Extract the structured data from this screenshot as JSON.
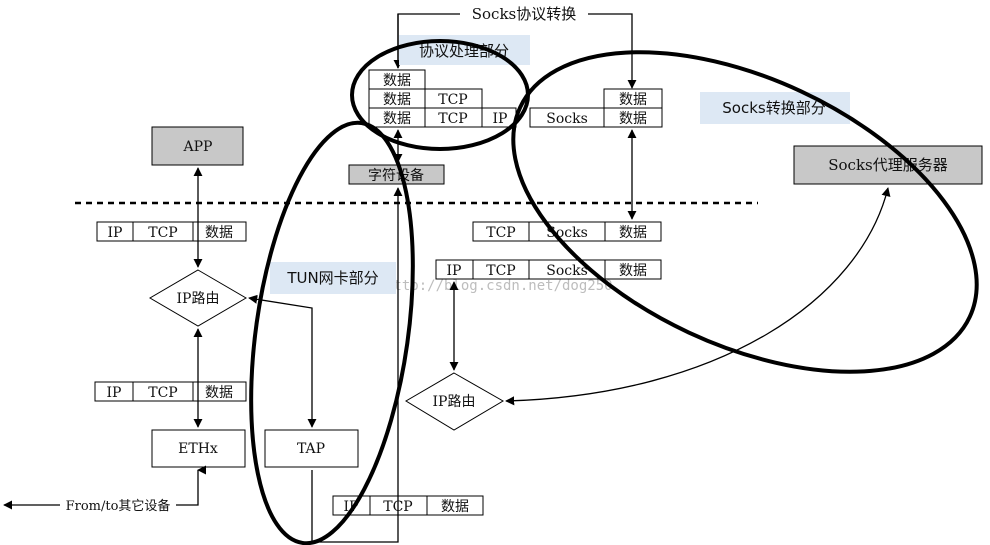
{
  "title_top": "Socks协议转换",
  "regions": {
    "protocol": "协议处理部分",
    "socks": "Socks转换部分",
    "tun": "TUN网卡部分"
  },
  "nodes": {
    "app": "APP",
    "char_device": "字符设备",
    "socks_proxy": "Socks代理服务器",
    "ip_route_left": "IP路由",
    "ip_route_right": "IP路由",
    "ethx": "ETHx",
    "tap": "TAP",
    "from_to": "From/to其它设备"
  },
  "packets": {
    "p1": [
      "数据"
    ],
    "p2": [
      "数据",
      "TCP"
    ],
    "p3": [
      "数据",
      "TCP",
      "IP"
    ],
    "p4": [
      "数据"
    ],
    "p5": [
      "Socks",
      "数据"
    ],
    "app_pkt": [
      "IP",
      "TCP",
      "数据"
    ],
    "eth_pkt": [
      "IP",
      "TCP",
      "数据"
    ],
    "tap_pkt": [
      "IP",
      "TCP",
      "数据"
    ],
    "socks_pkt1": [
      "TCP",
      "Socks",
      "数据"
    ],
    "socks_pkt2": [
      "IP",
      "TCP",
      "Socks",
      "数据"
    ]
  },
  "watermark": "http://blog.csdn.net/dog250",
  "colors": {
    "gray_box": "#c8c8c8",
    "label_bg": "#dde8f4",
    "line": "#000000"
  }
}
